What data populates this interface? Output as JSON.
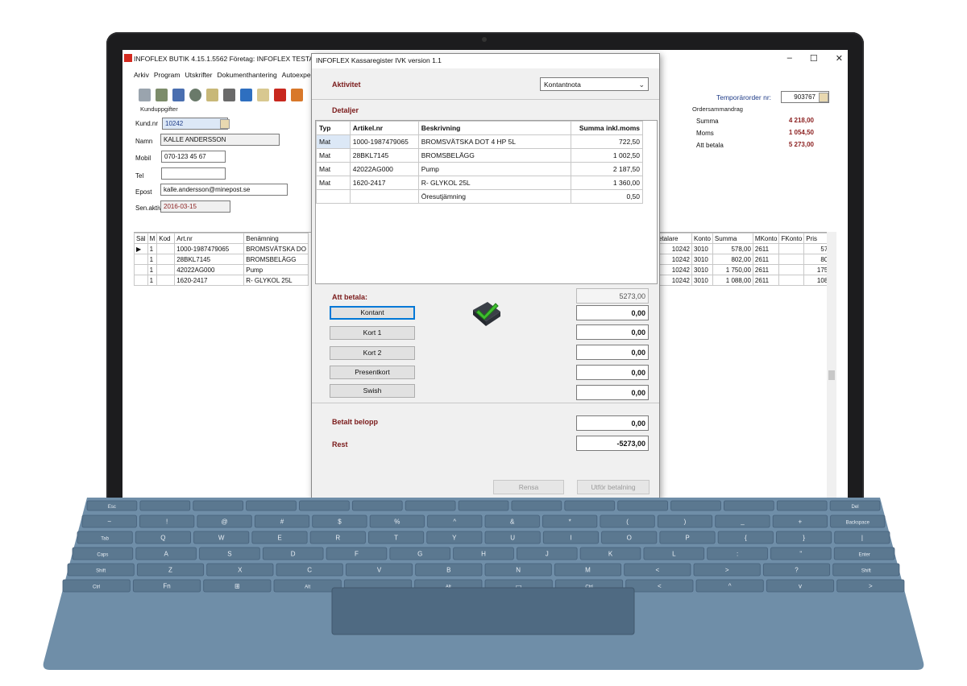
{
  "app": {
    "title": "INFOFLEX BUTIK 4.15.1.5562     Företag: INFOFLEX TESTAR",
    "menu": [
      "Arkiv",
      "Program",
      "Utskrifter",
      "Dokumenthantering",
      "Autoexper"
    ],
    "window_controls": [
      "–",
      "☐",
      "✕"
    ]
  },
  "customer": {
    "section": "Kunduppgifter",
    "kundnr_label": "Kund.nr",
    "kundnr": "10242",
    "namn_label": "Namn",
    "namn": "KALLE ANDERSSON",
    "mobil_label": "Mobil",
    "mobil": "070-123 45 67",
    "tel_label": "Tel",
    "tel": "",
    "epost_label": "Epost",
    "epost": "kalle.andersson@minepost.se",
    "senaktiv_label": "Sen.aktiv",
    "senaktiv": "2016-03-15"
  },
  "order": {
    "temp_label": "Temporärorder nr:",
    "temp_nr": "903767",
    "summary_section": "Ordersammandrag",
    "summa_label": "Summa",
    "summa": "4 218,00",
    "moms_label": "Moms",
    "moms": "1 054,50",
    "att_betala_label": "Att betala",
    "att_betala": "5 273,00"
  },
  "grid": {
    "left_headers": [
      "Säl",
      "M",
      "Kod",
      "Art.nr",
      "Benämning"
    ],
    "left_rows": [
      [
        "",
        "1",
        "",
        "1000-1987479065",
        "BROMSVÄTSKA DO"
      ],
      [
        "",
        "1",
        "",
        "28BKL7145",
        "BROMSBELÄGG"
      ],
      [
        "",
        "1",
        "",
        "42022AG000",
        "Pump"
      ],
      [
        "",
        "1",
        "",
        "1620-2417",
        "R- GLYKOL 25L"
      ]
    ],
    "right_headers": [
      "etalare",
      "Konto",
      "Summa",
      "MKonto",
      "FKonto",
      "Pris"
    ],
    "right_rows": [
      [
        "10242",
        "3010",
        "578,00",
        "2611",
        "",
        "57"
      ],
      [
        "10242",
        "3010",
        "802,00",
        "2611",
        "",
        "80"
      ],
      [
        "10242",
        "3010",
        "1 750,00",
        "2611",
        "",
        "175"
      ],
      [
        "10242",
        "3010",
        "1 088,00",
        "2611",
        "",
        "108"
      ]
    ]
  },
  "dialog": {
    "title": "INFOFLEX Kassaregister IVK version 1.1",
    "aktivitet_label": "Aktivitet",
    "aktivitet_value": "Kontantnota",
    "detaljer_label": "Detaljer",
    "headers": [
      "Typ",
      "Artikel.nr",
      "Beskrivning",
      "Summa inkl.moms"
    ],
    "rows": [
      [
        "Mat",
        "1000-1987479065",
        "BROMSVÄTSKA DOT 4 HP 5L",
        "722,50"
      ],
      [
        "Mat",
        "28BKL7145",
        "BROMSBELÄGG",
        "1 002,50"
      ],
      [
        "Mat",
        "42022AG000",
        "Pump",
        "2 187,50"
      ],
      [
        "Mat",
        "1620-2417",
        "R- GLYKOL 25L",
        "1 360,00"
      ],
      [
        "",
        "",
        "Öresutjämning",
        "0,50"
      ]
    ],
    "att_betala_label": "Att betala:",
    "att_betala_value": "5273,00",
    "payment_buttons": [
      "Kontant",
      "Kort 1",
      "Kort 2",
      "Presentkort",
      "Swish"
    ],
    "payment_amounts": [
      "0,00",
      "0,00",
      "0,00",
      "0,00",
      "0,00"
    ],
    "betalt_label": "Betalt belopp",
    "betalt_value": "0,00",
    "rest_label": "Rest",
    "rest_value": "-5273,00",
    "rensa_label": "Rensa",
    "utfor_label": "Utför betalning"
  },
  "keyboard": {
    "row0": [
      "Esc",
      "",
      "",
      "",
      "",
      "",
      "",
      "",
      "",
      "",
      "",
      "",
      "",
      "",
      "Del"
    ],
    "row1": [
      "~",
      "!",
      "@",
      "#",
      "$",
      "%",
      "^",
      "&",
      "*",
      "(",
      ")",
      "_",
      "+",
      "Backspace"
    ],
    "row2": [
      "Tab",
      "Q",
      "W",
      "E",
      "R",
      "T",
      "Y",
      "U",
      "I",
      "O",
      "P",
      "{",
      "}",
      "|"
    ],
    "row3": [
      "Caps",
      "A",
      "S",
      "D",
      "F",
      "G",
      "H",
      "J",
      "K",
      "L",
      ":",
      "\"",
      "Enter"
    ],
    "row4": [
      "Shift",
      "Z",
      "X",
      "C",
      "V",
      "B",
      "N",
      "M",
      "<",
      ">",
      "?",
      "Shift"
    ],
    "row5": [
      "Ctrl",
      "Fn",
      "⊞",
      "Alt",
      "",
      "Alt",
      "▭",
      "Ctrl",
      "<",
      "^",
      "v",
      ">"
    ]
  },
  "colors": {
    "accent_red": "#7a1a1a",
    "link_blue": "#1f3c88",
    "keyboard_blue": "#6f8ea8"
  }
}
